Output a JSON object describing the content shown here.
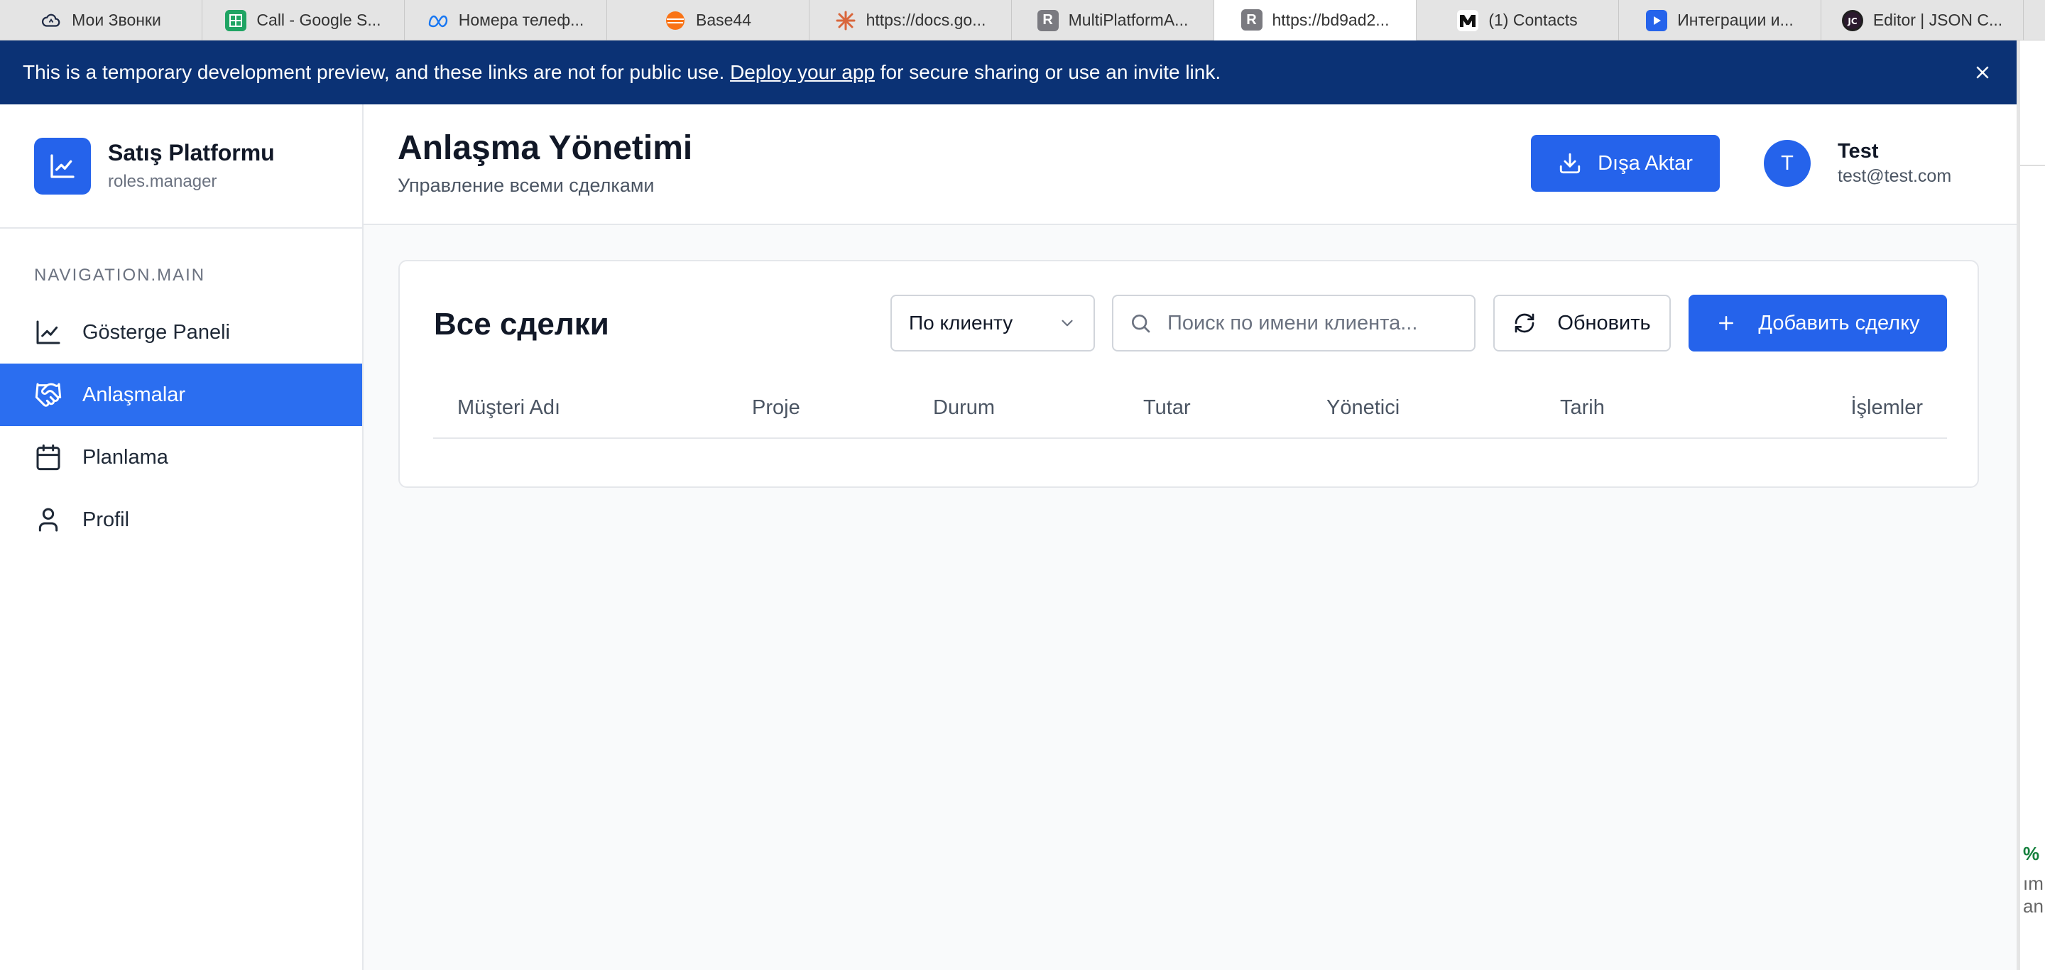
{
  "browser": {
    "tabs": [
      {
        "label": "Мои Звонки",
        "icon": "cloud-icon"
      },
      {
        "label": "Call - Google S...",
        "icon": "google-sheets-icon"
      },
      {
        "label": "Номера телеф...",
        "icon": "meta-icon"
      },
      {
        "label": "Base44",
        "icon": "base44-icon"
      },
      {
        "label": "https://docs.go...",
        "icon": "asterisk-icon"
      },
      {
        "label": "MultiPlatformA...",
        "icon": "replit-r-icon"
      },
      {
        "label": "https://bd9ad2...",
        "icon": "replit-r-icon",
        "active": true
      },
      {
        "label": "(1) Contacts",
        "icon": "m-logo-icon"
      },
      {
        "label": "Интеграции и...",
        "icon": "blue-app-icon"
      },
      {
        "label": "Editor | JSON C...",
        "icon": "jc-logo-icon"
      }
    ]
  },
  "banner": {
    "text_before": "This is a temporary development preview, and these links are not for public use. ",
    "link": "Deploy your app",
    "text_after": " for secure sharing or use an invite link."
  },
  "sidebar": {
    "brand_title": "Satış Platformu",
    "brand_subtitle": "roles.manager",
    "nav_heading": "NAVIGATION.MAIN",
    "items": [
      {
        "label": "Gösterge Paneli",
        "icon": "line-chart-icon"
      },
      {
        "label": "Anlaşmalar",
        "icon": "handshake-icon",
        "active": true
      },
      {
        "label": "Planlama",
        "icon": "calendar-icon"
      },
      {
        "label": "Profil",
        "icon": "user-icon"
      }
    ]
  },
  "header": {
    "title": "Anlaşma Yönetimi",
    "subtitle": "Управление всеми сделками",
    "export_label": "Dışa Aktar",
    "user": {
      "initial": "T",
      "name": "Test",
      "email": "test@test.com"
    }
  },
  "deals": {
    "title": "Все сделки",
    "filter_selected": "По клиенту",
    "search_placeholder": "Поиск по имени клиента...",
    "refresh_label": "Обновить",
    "add_label": "Добавить сделку",
    "columns": [
      "Müşteri Adı",
      "Proje",
      "Durum",
      "Tutar",
      "Yönetici",
      "Tarih",
      "İşlemler"
    ]
  },
  "gutter": {
    "line1": "%",
    "line2": "ım",
    "line3": "anı"
  },
  "colors": {
    "primary": "#2563eb",
    "banner": "#0b3275",
    "active_nav": "#2b6ef0"
  }
}
